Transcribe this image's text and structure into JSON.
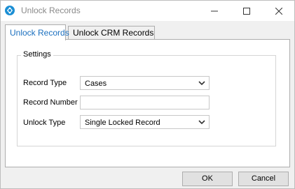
{
  "window": {
    "title": "Unlock Records"
  },
  "tabs": [
    {
      "label": "Unlock Records"
    },
    {
      "label": "Unlock CRM Records"
    }
  ],
  "settings": {
    "legend": "Settings",
    "record_type": {
      "label": "Record Type",
      "value": "Cases"
    },
    "record_number": {
      "label": "Record Number",
      "value": ""
    },
    "unlock_type": {
      "label": "Unlock Type",
      "value": "Single Locked Record"
    }
  },
  "buttons": {
    "ok": "OK",
    "cancel": "Cancel"
  },
  "colors": {
    "active_tab_text": "#1a6fbf",
    "app_icon": "#1c8fd4"
  }
}
